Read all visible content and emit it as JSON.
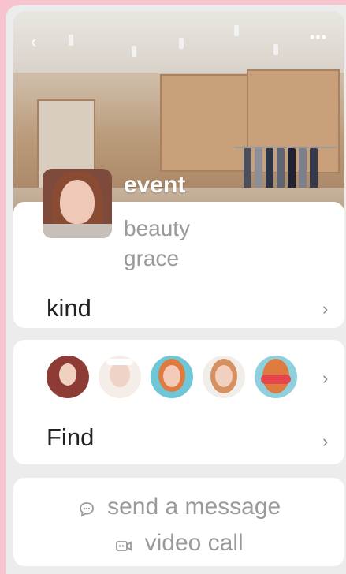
{
  "header": {
    "back_icon": "chevron-left-icon",
    "more_icon": "more-horizontal-icon"
  },
  "profile": {
    "title": "event",
    "subtitle": "beauty grace",
    "kind": "kind"
  },
  "find": {
    "label": "Find",
    "avatars": [
      {
        "name": "avatar-1",
        "bg": "#8f3b35"
      },
      {
        "name": "avatar-2",
        "bg": "#f5ede8"
      },
      {
        "name": "avatar-3",
        "bg": "#6ec6d6"
      },
      {
        "name": "avatar-4",
        "bg": "#f1eee9"
      },
      {
        "name": "avatar-5",
        "bg": "#8fd0df"
      }
    ]
  },
  "actions": {
    "message": "send a message",
    "video": "video call"
  }
}
